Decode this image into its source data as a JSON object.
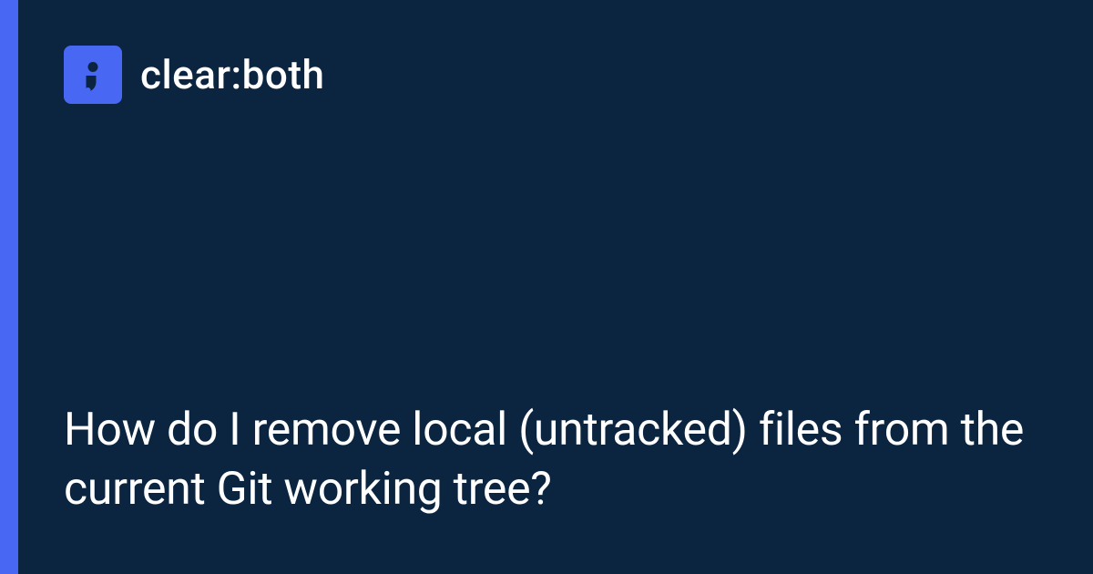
{
  "brand": {
    "name": "clear:both"
  },
  "article": {
    "title": "How do I remove local (untracked) files from the current Git working tree?"
  },
  "colors": {
    "accent": "#4868f4",
    "background": "#0b2540",
    "text": "#ffffff"
  }
}
